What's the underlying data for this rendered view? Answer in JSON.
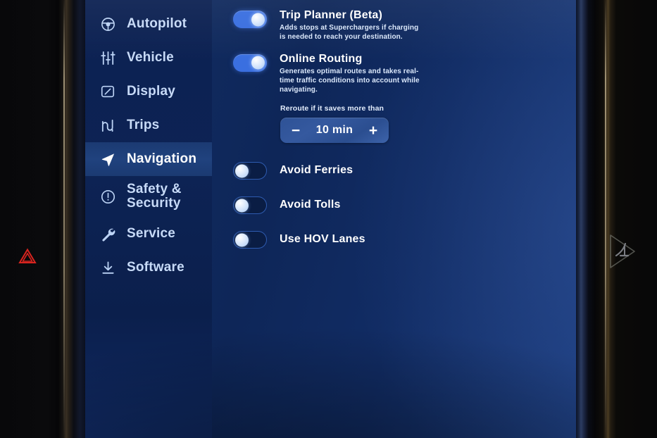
{
  "sidebar": {
    "items": [
      {
        "label": "Autopilot",
        "icon": "steering-wheel-icon",
        "active": false
      },
      {
        "label": "Vehicle",
        "icon": "sliders-icon",
        "active": false
      },
      {
        "label": "Display",
        "icon": "display-icon",
        "active": false
      },
      {
        "label": "Trips",
        "icon": "winding-road-icon",
        "active": false
      },
      {
        "label": "Navigation",
        "icon": "navigation-arrow-icon",
        "active": true
      },
      {
        "label": "Safety & Security",
        "icon": "alert-circle-icon",
        "active": false
      },
      {
        "label": "Service",
        "icon": "wrench-icon",
        "active": false
      },
      {
        "label": "Software",
        "icon": "download-icon",
        "active": false
      }
    ]
  },
  "settings": {
    "trip_planner": {
      "title": "Trip Planner (Beta)",
      "description": "Adds stops at Superchargers if charging is needed to reach your destination.",
      "state": "on"
    },
    "online_routing": {
      "title": "Online Routing",
      "description": "Generates optimal routes and takes real-time traffic conditions into account while navigating.",
      "state": "on"
    },
    "reroute": {
      "label": "Reroute if it saves more than",
      "value": "10 min",
      "decrement": "−",
      "increment": "+"
    },
    "avoid_ferries": {
      "title": "Avoid Ferries",
      "state": "off"
    },
    "avoid_tolls": {
      "title": "Avoid Tolls",
      "state": "off"
    },
    "hov_lanes": {
      "title": "Use HOV Lanes",
      "state": "off"
    }
  },
  "bezel": {
    "hazard_icon": "hazard-warning-triangle-icon",
    "defrost_icon": "rear-defrost-icon"
  },
  "colors": {
    "screen_blue": "#0d2352",
    "sidebar_blue": "#0c2152",
    "active_row": "#20427e",
    "toggle_on": "#3a6fe0",
    "toggle_border_off": "#2e5bb0",
    "stepper_blue": "#35599f",
    "text_primary": "#ffffff",
    "text_secondary": "#dbe8fb",
    "nav_label": "#c7daf7",
    "hazard_red": "#e01b1b"
  }
}
